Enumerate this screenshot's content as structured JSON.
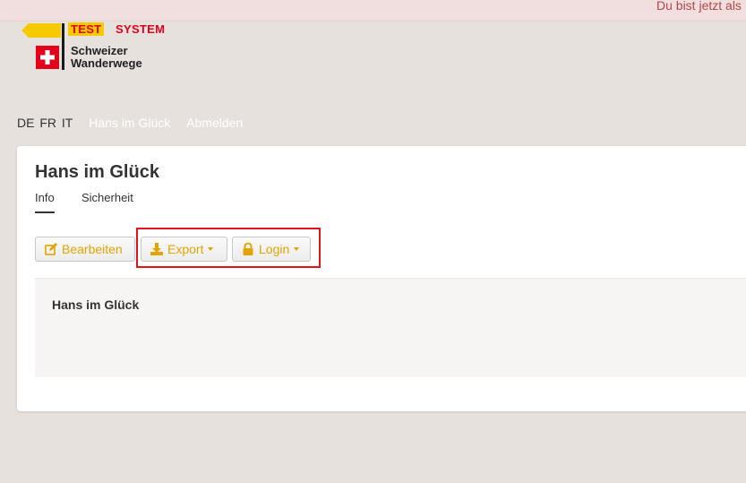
{
  "banner": {
    "text": "Du bist jetzt als"
  },
  "logo": {
    "test_label": "TEST",
    "system_label": "SYSTEM",
    "brand_line1": "Schweizer",
    "brand_line2": "Wanderwege",
    "colors": {
      "red": "#e2001a",
      "yellow": "#f7c900"
    }
  },
  "topnav": {
    "languages": [
      "DE",
      "FR",
      "IT"
    ],
    "user_link": "Hans im Glück",
    "logout_link": "Abmelden"
  },
  "page": {
    "title": "Hans im Glück",
    "tabs": [
      {
        "label": "Info",
        "active": true
      },
      {
        "label": "Sicherheit",
        "active": false
      }
    ],
    "buttons": {
      "edit": "Bearbeiten",
      "export": "Export",
      "login": "Login"
    },
    "content_name": "Hans im Glück"
  },
  "colors": {
    "accent": "#e2a400",
    "highlight": "#e0131b",
    "background": "#e7e1dd"
  }
}
